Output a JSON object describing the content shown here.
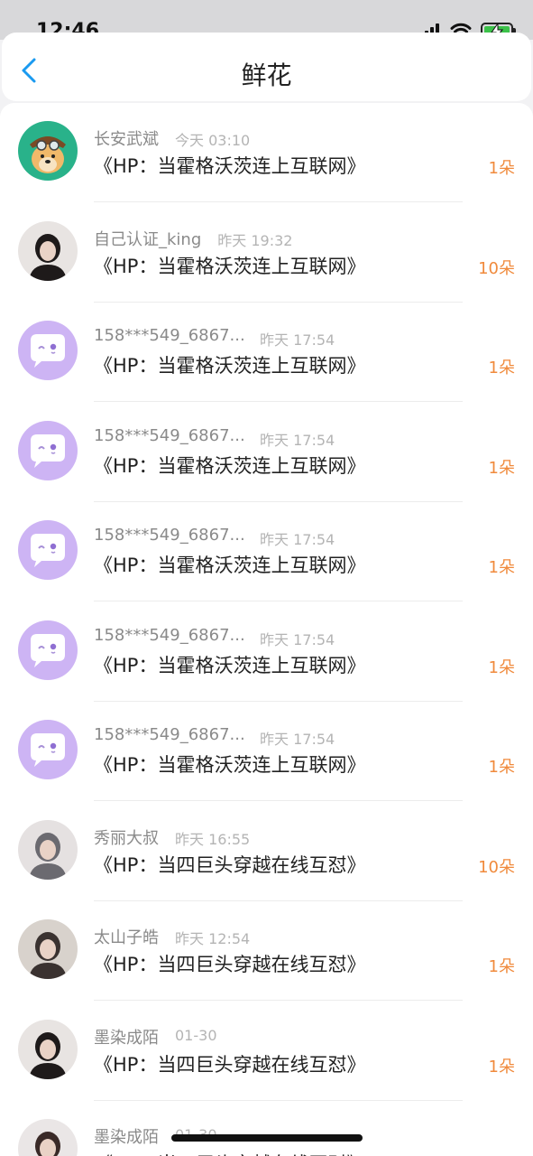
{
  "status_bar": {
    "time": "12:46"
  },
  "header": {
    "title": "鲜花"
  },
  "colors": {
    "accent": "#1a9af0",
    "count": "#f08a3c",
    "default_avatar": "#cdb4f4"
  },
  "messages": [
    {
      "username": "长安武斌",
      "time": "今天 03:10",
      "book": "《HP：当霍格沃茨连上互联网》",
      "count": "1朵",
      "avatar": "doge-avatar"
    },
    {
      "username": "自己认证_king",
      "time": "昨天 19:32",
      "book": "《HP：当霍格沃茨连上互联网》",
      "count": "10朵",
      "avatar": "photo-avatar"
    },
    {
      "username": "158***549_6867...",
      "time": "昨天 17:54",
      "book": "《HP：当霍格沃茨连上互联网》",
      "count": "1朵",
      "avatar": "default-chat-avatar"
    },
    {
      "username": "158***549_6867...",
      "time": "昨天 17:54",
      "book": "《HP：当霍格沃茨连上互联网》",
      "count": "1朵",
      "avatar": "default-chat-avatar"
    },
    {
      "username": "158***549_6867...",
      "time": "昨天 17:54",
      "book": "《HP：当霍格沃茨连上互联网》",
      "count": "1朵",
      "avatar": "default-chat-avatar"
    },
    {
      "username": "158***549_6867...",
      "time": "昨天 17:54",
      "book": "《HP：当霍格沃茨连上互联网》",
      "count": "1朵",
      "avatar": "default-chat-avatar"
    },
    {
      "username": "158***549_6867...",
      "time": "昨天 17:54",
      "book": "《HP：当霍格沃茨连上互联网》",
      "count": "1朵",
      "avatar": "default-chat-avatar"
    },
    {
      "username": "秀丽大叔",
      "time": "昨天 16:55",
      "book": "《HP：当四巨头穿越在线互怼》",
      "count": "10朵",
      "avatar": "photo-avatar"
    },
    {
      "username": "太山子皓",
      "time": "昨天 12:54",
      "book": "《HP：当四巨头穿越在线互怼》",
      "count": "1朵",
      "avatar": "photo-avatar"
    },
    {
      "username": "墨染成陌",
      "time": "01-30",
      "book": "《HP：当四巨头穿越在线互怼》",
      "count": "1朵",
      "avatar": "photo-avatar"
    },
    {
      "username": "墨染成陌",
      "time": "01-30",
      "book": "《HP：当四巨头穿越在线互怼》",
      "count": "",
      "avatar": "photo-avatar"
    }
  ]
}
